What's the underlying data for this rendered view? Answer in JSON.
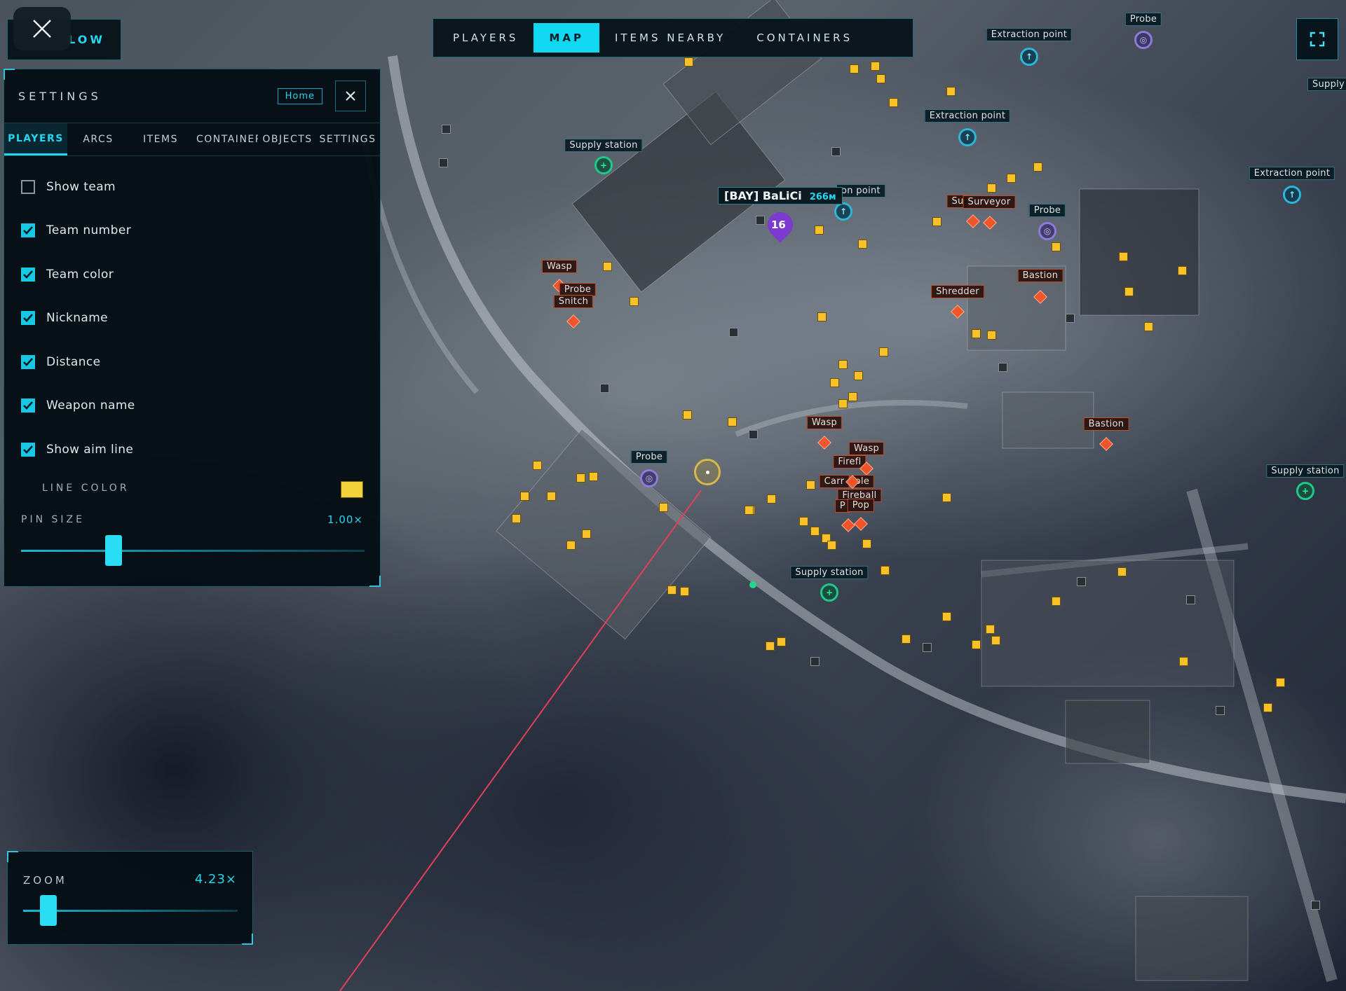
{
  "top_nav": {
    "tabs": [
      {
        "label": "PLAYERS",
        "active": false
      },
      {
        "label": "MAP",
        "active": true
      },
      {
        "label": "ITEMS NEARBY",
        "active": false
      },
      {
        "label": "CONTAINERS",
        "active": false
      }
    ]
  },
  "follow_button": {
    "label": "LOW"
  },
  "settings": {
    "title": "SETTINGS",
    "home_label": "Home",
    "tabs": [
      {
        "label": "PLAYERS",
        "active": true
      },
      {
        "label": "ARCS",
        "active": false
      },
      {
        "label": "ITEMS",
        "active": false
      },
      {
        "label": "CONTAINERS",
        "active": false
      },
      {
        "label": "OBJECTS",
        "active": false
      },
      {
        "label": "SETTINGS",
        "active": false
      }
    ],
    "options": [
      {
        "label": "Show team",
        "checked": false
      },
      {
        "label": "Team number",
        "checked": true
      },
      {
        "label": "Team color",
        "checked": true
      },
      {
        "label": "Nickname",
        "checked": true
      },
      {
        "label": "Distance",
        "checked": true
      },
      {
        "label": "Weapon name",
        "checked": true
      },
      {
        "label": "Show aim line",
        "checked": true
      }
    ],
    "line_color_label": "LINE COLOR",
    "line_color": "#f2d23a",
    "pin_size_label": "PIN SIZE",
    "pin_size_value": "1.00×",
    "pin_size_fraction": 0.27
  },
  "zoom": {
    "label": "ZOOM",
    "value": "4.23×",
    "fraction": 0.08
  },
  "player": {
    "tag": "[BAY] BaLiCi",
    "distance": "266м",
    "team_number": "16"
  },
  "map_labels": {
    "supply_station": "Supply station",
    "extraction_point": "Extraction point",
    "probe": "Probe",
    "wasp": "Wasp",
    "snitch": "Snitch",
    "surveyor": "Surveyor",
    "su": "Su",
    "bastion": "Bastion",
    "shredder": "Shredder",
    "firefly": "Firefl",
    "carr": "Carr",
    "ole": "ole",
    "pop": "Pop",
    "fireball": "Fireball",
    "pc": "P",
    "ion_point": "on point",
    "supply_edge": "Supply"
  },
  "colors": {
    "accent": "#10d8f0",
    "enemy": "#f0542a",
    "item": "#f6c12a",
    "supply": "#1fc98a",
    "extraction": "#2cb6d8",
    "probe": "#8d7bd6",
    "aim_line": "#e0405a"
  }
}
